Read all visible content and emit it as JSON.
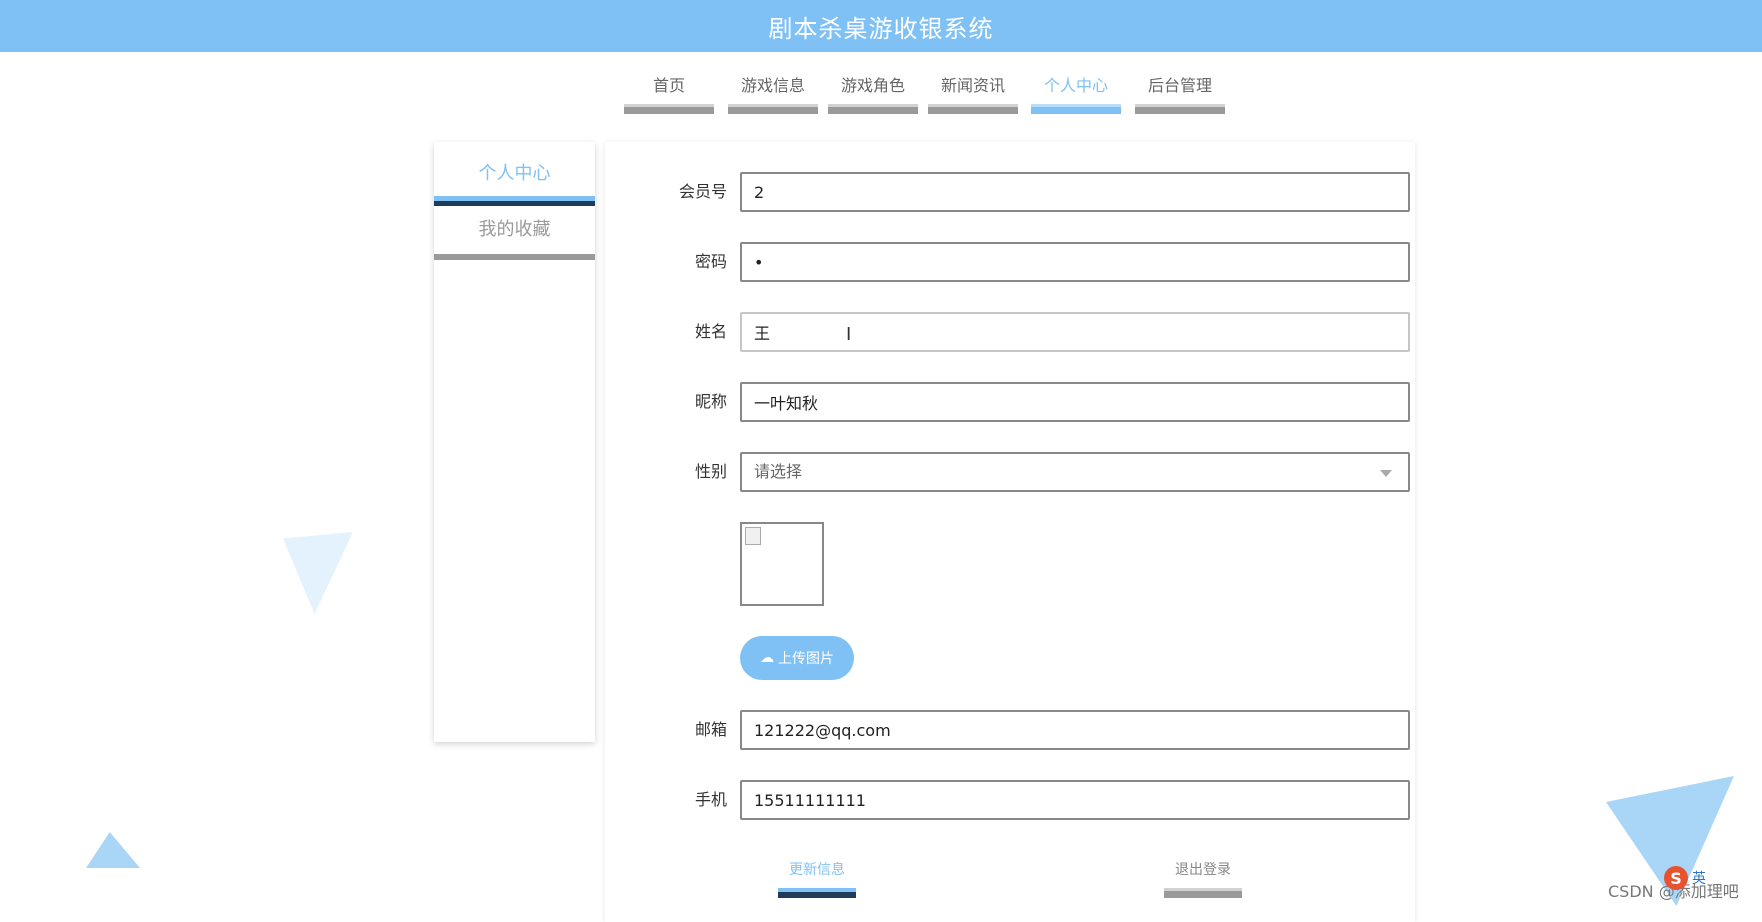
{
  "header": {
    "title": "剧本杀桌游收银系统"
  },
  "nav": {
    "items": [
      {
        "label": "首页",
        "active": false
      },
      {
        "label": "游戏信息",
        "active": false
      },
      {
        "label": "游戏角色",
        "active": false
      },
      {
        "label": "新闻资讯",
        "active": false
      },
      {
        "label": "个人中心",
        "active": true
      },
      {
        "label": "后台管理",
        "active": false
      }
    ]
  },
  "sidebar": {
    "items": [
      {
        "label": "个人中心",
        "active": true
      },
      {
        "label": "我的收藏",
        "active": false
      }
    ]
  },
  "form": {
    "member_no": {
      "label": "会员号",
      "value": "2"
    },
    "password": {
      "label": "密码",
      "value": "•"
    },
    "name": {
      "label": "姓名",
      "value": "王"
    },
    "nickname": {
      "label": "昵称",
      "value": "一叶知秋"
    },
    "gender": {
      "label": "性别",
      "placeholder": "请选择"
    },
    "upload_label": "上传图片",
    "email": {
      "label": "邮箱",
      "value": "121222@qq.com"
    },
    "phone": {
      "label": "手机",
      "value": "15511111111"
    }
  },
  "actions": {
    "update": "更新信息",
    "logout": "退出登录"
  },
  "ime": {
    "logo": "S",
    "mode": "英"
  },
  "watermark": "CSDN @添加理吧",
  "colors": {
    "primary": "#7fc1f5",
    "dark_bar": "#1e3b5a",
    "inactive_bar": "#9a9a9a"
  },
  "icons": {
    "upload": "cloud-upload-icon",
    "select_caret": "chevron-down-icon",
    "cursor": "text-cursor-icon"
  }
}
